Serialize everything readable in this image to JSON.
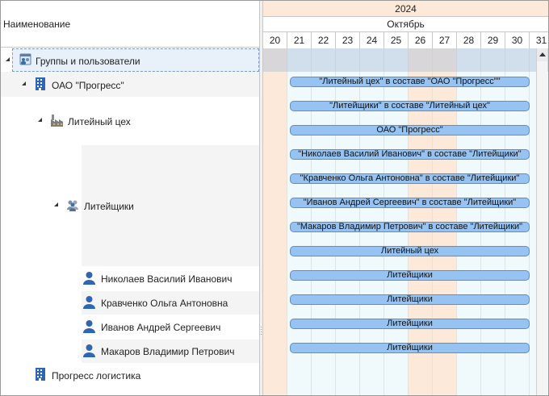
{
  "tree": {
    "header": "Наименование",
    "nodes": [
      {
        "label": "Группы и пользователи",
        "icon": "users-group-icon"
      },
      {
        "label": "ОАО \"Прогресс\"",
        "icon": "building-icon"
      },
      {
        "label": "Литейный цех",
        "icon": "factory-icon"
      },
      {
        "label": "Литейщики",
        "icon": "team-icon"
      },
      {
        "label": "Николаев Василий Иванович",
        "icon": "user-icon"
      },
      {
        "label": "Кравченко Ольга Антоновна",
        "icon": "user-icon"
      },
      {
        "label": "Иванов Андрей Сергеевич",
        "icon": "user-icon"
      },
      {
        "label": "Макаров Владимир Петрович",
        "icon": "user-icon"
      },
      {
        "label": "Прогресс логистика",
        "icon": "building-icon"
      }
    ]
  },
  "timeline": {
    "year": "2024",
    "month": "Октябрь",
    "days": [
      "20",
      "21",
      "22",
      "23",
      "24",
      "25",
      "26",
      "27",
      "28",
      "29",
      "30",
      "31"
    ],
    "weekend_days": [
      "20",
      "26",
      "27"
    ]
  },
  "bars": [
    {
      "label": "\"Литейный цех\" в составе \"ОАО \"Прогресс\"\""
    },
    {
      "label": "\"Литейщики\" в составе \"Литейный цех\""
    },
    {
      "label": "ОАО \"Прогресс\""
    },
    {
      "label": "\"Николаев Василий Иванович\" в составе \"Литейщики\""
    },
    {
      "label": "\"Кравченко Ольга Антоновна\" в составе \"Литейщики\""
    },
    {
      "label": "\"Иванов Андрей Сергеевич\" в составе \"Литейщики\""
    },
    {
      "label": "\"Макаров Владимир Петрович\" в составе \"Литейщики\""
    },
    {
      "label": "Литейный цех"
    },
    {
      "label": "Литейщики"
    },
    {
      "label": "Литейщики"
    },
    {
      "label": "Литейщики"
    },
    {
      "label": "Литейщики"
    }
  ],
  "colors": {
    "bar_fill": "#96c3f2",
    "bar_border": "#5b8fc9",
    "weekend": "#fde9d9",
    "weekday": "#f0fafd",
    "year_header": "#fde9d9"
  }
}
